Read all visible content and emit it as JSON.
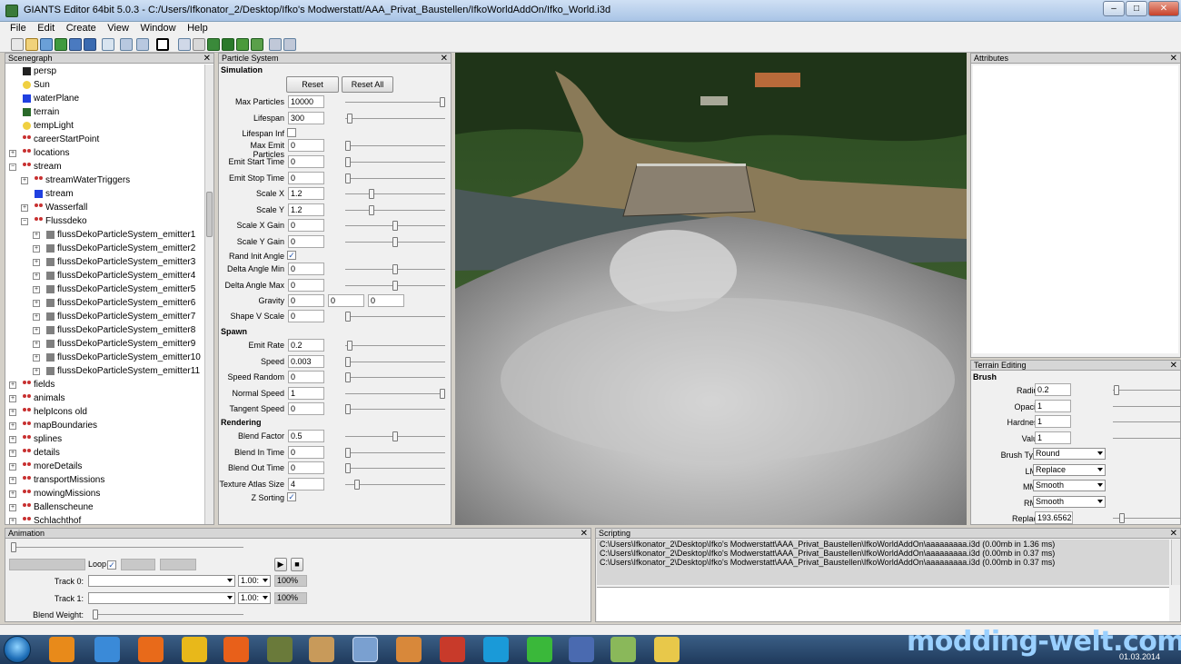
{
  "window": {
    "title": "GIANTS Editor 64bit 5.0.3 - C:/Users/Ifkonator_2/Desktop/Ifko's Modwerstatt/AAA_Privat_Baustellen/IfkoWorldAddOn/Ifko_World.i3d",
    "minimize": "–",
    "maximize": "□",
    "close": "✕"
  },
  "menu": [
    "File",
    "Edit",
    "Create",
    "View",
    "Window",
    "Help"
  ],
  "scenegraph": {
    "title": "Scenegraph",
    "items": [
      {
        "label": "persp",
        "icon": "camera-icon"
      },
      {
        "label": "Sun",
        "icon": "light-icon"
      },
      {
        "label": "waterPlane",
        "icon": "shape-icon"
      },
      {
        "label": "terrain",
        "icon": "terrain-icon"
      },
      {
        "label": "tempLight",
        "icon": "light-icon"
      },
      {
        "label": "careerStartPoint",
        "icon": "transformgroup-icon"
      },
      {
        "label": "locations",
        "icon": "transformgroup-icon"
      },
      {
        "label": "stream",
        "icon": "transformgroup-icon"
      },
      {
        "label": "streamWaterTriggers",
        "icon": "transformgroup-icon"
      },
      {
        "label": "stream",
        "icon": "shape-icon"
      },
      {
        "label": "Wasserfall",
        "icon": "transformgroup-icon"
      },
      {
        "label": "Flussdeko",
        "icon": "transformgroup-icon"
      },
      {
        "label": "flussDekoParticleSystem_emitter1",
        "icon": "particle-icon"
      },
      {
        "label": "flussDekoParticleSystem_emitter2",
        "icon": "particle-icon"
      },
      {
        "label": "flussDekoParticleSystem_emitter3",
        "icon": "particle-icon"
      },
      {
        "label": "flussDekoParticleSystem_emitter4",
        "icon": "particle-icon"
      },
      {
        "label": "flussDekoParticleSystem_emitter5",
        "icon": "particle-icon"
      },
      {
        "label": "flussDekoParticleSystem_emitter6",
        "icon": "particle-icon"
      },
      {
        "label": "flussDekoParticleSystem_emitter7",
        "icon": "particle-icon"
      },
      {
        "label": "flussDekoParticleSystem_emitter8",
        "icon": "particle-icon"
      },
      {
        "label": "flussDekoParticleSystem_emitter9",
        "icon": "particle-icon"
      },
      {
        "label": "flussDekoParticleSystem_emitter10",
        "icon": "particle-icon"
      },
      {
        "label": "flussDekoParticleSystem_emitter11",
        "icon": "particle-icon"
      },
      {
        "label": "fields",
        "icon": "transformgroup-icon"
      },
      {
        "label": "animals",
        "icon": "transformgroup-icon"
      },
      {
        "label": "helpIcons old",
        "icon": "transformgroup-icon"
      },
      {
        "label": "mapBoundaries",
        "icon": "transformgroup-icon"
      },
      {
        "label": "splines",
        "icon": "transformgroup-icon"
      },
      {
        "label": "details",
        "icon": "transformgroup-icon"
      },
      {
        "label": "moreDetails",
        "icon": "transformgroup-icon"
      },
      {
        "label": "transportMissions",
        "icon": "transformgroup-icon"
      },
      {
        "label": "mowingMissions",
        "icon": "transformgroup-icon"
      },
      {
        "label": "Ballenscheune",
        "icon": "transformgroup-icon"
      },
      {
        "label": "Schlachthof",
        "icon": "transformgroup-icon"
      }
    ]
  },
  "particle_system": {
    "title": "Particle System",
    "sections": {
      "simulation": "Simulation",
      "spawn": "Spawn",
      "rendering": "Rendering"
    },
    "reset": "Reset",
    "reset_all": "Reset All",
    "fields": [
      {
        "label": "Max Particles",
        "value": "10000",
        "slider": 1.0
      },
      {
        "label": "Lifespan",
        "value": "300",
        "slider": 0.02
      },
      {
        "label": "Lifespan Inf",
        "checkbox": false
      },
      {
        "label": "Max Emit Particles",
        "value": "0",
        "slider": 0.0
      },
      {
        "label": "Emit Start Time",
        "value": "0",
        "slider": 0.0
      },
      {
        "label": "Emit Stop Time",
        "value": "0",
        "slider": 0.0
      },
      {
        "label": "Scale X",
        "value": "1.2",
        "slider": 0.25
      },
      {
        "label": "Scale Y",
        "value": "1.2",
        "slider": 0.25
      },
      {
        "label": "Scale X Gain",
        "value": "0",
        "slider": 0.5
      },
      {
        "label": "Scale Y Gain",
        "value": "0",
        "slider": 0.5
      },
      {
        "label": "Rand Init Angle",
        "checkbox": true
      },
      {
        "label": "Delta Angle Min",
        "value": "0",
        "slider": 0.5
      },
      {
        "label": "Delta Angle Max",
        "value": "0",
        "slider": 0.5
      },
      {
        "label": "Gravity",
        "values": [
          "0",
          "0",
          "0"
        ]
      },
      {
        "label": "Shape V Scale",
        "value": "0",
        "slider": 0.0
      },
      {
        "label": "Emit Rate",
        "value": "0.2",
        "slider": 0.02
      },
      {
        "label": "Speed",
        "value": "0.003",
        "slider": 0.0
      },
      {
        "label": "Speed Random",
        "value": "0",
        "slider": 0.0
      },
      {
        "label": "Normal Speed",
        "value": "1",
        "slider": 1.0
      },
      {
        "label": "Tangent Speed",
        "value": "0",
        "slider": 0.0
      },
      {
        "label": "Blend Factor",
        "value": "0.5",
        "slider": 0.5
      },
      {
        "label": "Blend In Time",
        "value": "0",
        "slider": 0.0
      },
      {
        "label": "Blend Out Time",
        "value": "0",
        "slider": 0.0
      },
      {
        "label": "Texture Atlas Size",
        "value": "4",
        "slider": 0.1
      },
      {
        "label": "Z Sorting",
        "checkbox": true
      }
    ]
  },
  "attributes": {
    "title": "Attributes"
  },
  "terrain_editing": {
    "title": "Terrain Editing",
    "brush_label": "Brush",
    "radius": {
      "label": "Radius",
      "value": "0.2",
      "slider": 0.02
    },
    "opacity": {
      "label": "Opacity",
      "value": "1"
    },
    "hardness": {
      "label": "Hardness",
      "value": "1"
    },
    "value": {
      "label": "Value",
      "value": "1"
    },
    "brush_type": {
      "label": "Brush Type",
      "value": "Round"
    },
    "lmb": {
      "label": "LMB",
      "value": "Replace"
    },
    "mmb": {
      "label": "MMB",
      "value": "Smooth"
    },
    "rmb": {
      "label": "RMB",
      "value": "Smooth"
    },
    "replace": {
      "label": "Replace",
      "value": "193.65621",
      "slider": 0.1
    }
  },
  "animation": {
    "title": "Animation",
    "loop": "Loop",
    "loop_checked": true,
    "track0": "Track 0:",
    "track1": "Track 1:",
    "speed0": "1.00:",
    "speed1": "1.00:",
    "pct0": "100%",
    "pct1": "100%",
    "blend_weight": "Blend Weight:"
  },
  "scripting": {
    "title": "Scripting",
    "lines": [
      "C:\\Users\\Ifkonator_2\\Desktop\\Ifko's Modwerstatt\\AAA_Privat_Baustellen\\IfkoWorldAddOn\\aaaaaaaaa.i3d (0.00mb in 1.36 ms)",
      "C:\\Users\\Ifkonator_2\\Desktop\\Ifko's Modwerstatt\\AAA_Privat_Baustellen\\IfkoWorldAddOn\\aaaaaaaaa.i3d (0.00mb in 0.37 ms)",
      "C:\\Users\\Ifkonator_2\\Desktop\\Ifko's Modwerstatt\\AAA_Privat_Baustellen\\IfkoWorldAddOn\\aaaaaaaaa.i3d (0.00mb in 0.37 ms)"
    ]
  },
  "watermark": "modding-welt.com",
  "taskbar_date": "01.03.2014",
  "colors": {
    "panel_bg": "#f0f0f0",
    "taskbar": "#1f3a5c",
    "watermark": "#9ad0ff"
  }
}
